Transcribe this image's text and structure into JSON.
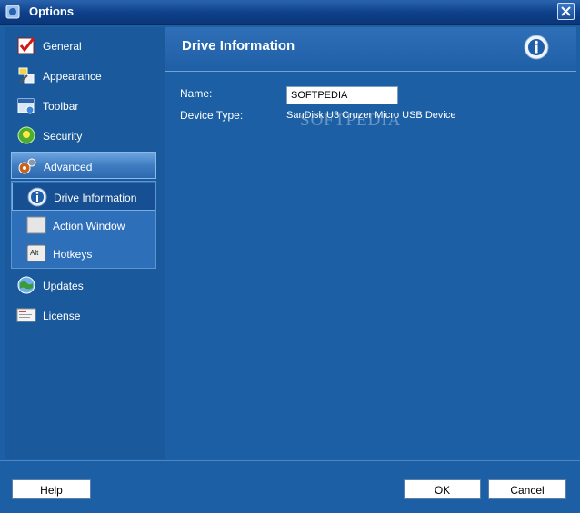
{
  "window": {
    "title": "Options"
  },
  "sidebar": {
    "items": [
      {
        "label": "General",
        "icon": "checkbox-icon"
      },
      {
        "label": "Appearance",
        "icon": "paint-icon"
      },
      {
        "label": "Toolbar",
        "icon": "toolbar-icon"
      },
      {
        "label": "Security",
        "icon": "shield-icon"
      },
      {
        "label": "Advanced",
        "icon": "gears-icon",
        "selected": true
      }
    ],
    "advanced_subitems": [
      {
        "label": "Drive Information",
        "icon": "info-icon",
        "selected": true
      },
      {
        "label": "Action Window",
        "icon": "window-icon"
      },
      {
        "label": "Hotkeys",
        "icon": "alt-key-icon",
        "key_text": "Alt"
      }
    ],
    "bottom_items": [
      {
        "label": "Updates",
        "icon": "globe-icon"
      },
      {
        "label": "License",
        "icon": "license-icon"
      }
    ]
  },
  "content": {
    "title": "Drive Information",
    "name_label": "Name:",
    "name_value": "SOFTPEDIA",
    "device_label": "Device Type:",
    "device_value": "SanDisk U3 Cruzer Micro USB Device",
    "watermark": "SOFTPEDIA"
  },
  "footer": {
    "help": "Help",
    "ok": "OK",
    "cancel": "Cancel"
  },
  "colors": {
    "background": "#1c5fa4",
    "titlebar": "#0d3f8a",
    "selected": "#3f7dc2"
  }
}
